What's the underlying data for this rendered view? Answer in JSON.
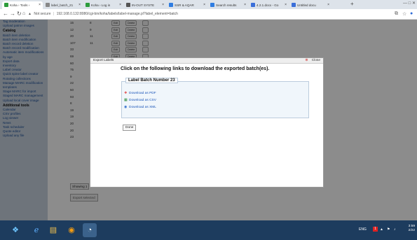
{
  "browser": {
    "tabs": [
      {
        "label": "Koha › Tools ›",
        "fav": "#2d9c3c",
        "active": true
      },
      {
        "label": "label_batch_21",
        "fav": "#888888",
        "active": false
      },
      {
        "label": "Koha › Log in",
        "fav": "#2d9c3c",
        "active": false
      },
      {
        "label": "IN-OUT SYSTE",
        "fav": "#555555",
        "active": false
      },
      {
        "label": "SSR & AQAR",
        "fav": "#2f7de1",
        "active": false
      },
      {
        "label": "Search results",
        "fav": "#2f7de1",
        "active": false
      },
      {
        "label": "4.2.1.docx - Go",
        "fav": "#3b6fd9",
        "active": false
      },
      {
        "label": "Untitled docu",
        "fav": "#3b6fd9",
        "active": false
      }
    ],
    "url_warning": "Not secure",
    "url": "192.168.0.132:8080/cgi-bin/koha/labels/label-manage.pl?label_element=batch"
  },
  "sidebar": {
    "items": [
      {
        "text": "Tag moderation",
        "head": false
      },
      {
        "text": "Upload patron images",
        "head": false
      },
      {
        "text": "Catalog",
        "head": true
      },
      {
        "text": "Batch item deletion",
        "head": false
      },
      {
        "text": "Batch item modification",
        "head": false
      },
      {
        "text": "Batch record deletion",
        "head": false
      },
      {
        "text": "Batch record modification",
        "head": false
      },
      {
        "text": "Automatic item modifications",
        "head": false
      },
      {
        "text": "by age",
        "head": false
      },
      {
        "text": "Export data",
        "head": false
      },
      {
        "text": "Inventory",
        "head": false
      },
      {
        "text": "Label creator",
        "head": false
      },
      {
        "text": "Quick spine label creator",
        "head": false
      },
      {
        "text": "Rotating collections",
        "head": false
      },
      {
        "text": "Manage MARC modification",
        "head": false
      },
      {
        "text": "templates",
        "head": false
      },
      {
        "text": "Stage MARC for import",
        "head": false
      },
      {
        "text": "Staged MARC management",
        "head": false
      },
      {
        "text": "Upload local cover image",
        "head": false
      },
      {
        "text": "Additional tools",
        "head": true
      },
      {
        "text": "Calendar",
        "head": false
      },
      {
        "text": "CSV profiles",
        "head": false
      },
      {
        "text": "Log viewer",
        "head": false
      },
      {
        "text": "News",
        "head": false
      },
      {
        "text": "Task scheduler",
        "head": false
      },
      {
        "text": "Quote editor",
        "head": false
      },
      {
        "text": "Upload any file",
        "head": false
      }
    ]
  },
  "table": {
    "rows": [
      {
        "n": "15",
        "n2": "8"
      },
      {
        "n": "12",
        "n2": "9"
      },
      {
        "n": "20",
        "n2": "11"
      },
      {
        "n": "107",
        "n2": "11"
      },
      {
        "n": "33",
        "n2": ""
      },
      {
        "n": "69",
        "n2": ""
      },
      {
        "n": "60",
        "n2": ""
      },
      {
        "n": "75",
        "n2": ""
      },
      {
        "n": "9",
        "n2": ""
      },
      {
        "n": "22",
        "n2": ""
      },
      {
        "n": "50",
        "n2": ""
      },
      {
        "n": "93",
        "n2": ""
      },
      {
        "n": "8",
        "n2": ""
      },
      {
        "n": "19",
        "n2": ""
      },
      {
        "n": "19",
        "n2": ""
      },
      {
        "n": "20",
        "n2": ""
      },
      {
        "n": "20",
        "n2": ""
      },
      {
        "n": "23",
        "n2": ""
      }
    ],
    "edit_label": "Edit",
    "delete_label": "Delete",
    "showing_label": "Showing 1",
    "export_selected_label": "Export selected"
  },
  "modal": {
    "title": "Export Labels",
    "close_label": "Close",
    "heading": "Click on the following links to download the exported batch(es).",
    "legend": "Label Batch Number 23",
    "links": [
      {
        "label": "Download as PDF",
        "icon": "pdf-icon"
      },
      {
        "label": "Download as CSV",
        "icon": "csv-icon"
      },
      {
        "label": "Download as XML",
        "icon": "xml-icon"
      }
    ],
    "done_label": "Done"
  },
  "taskbar": {
    "lang": "ENG",
    "notify_count": "1",
    "time": "3:59",
    "date": "2/22"
  }
}
